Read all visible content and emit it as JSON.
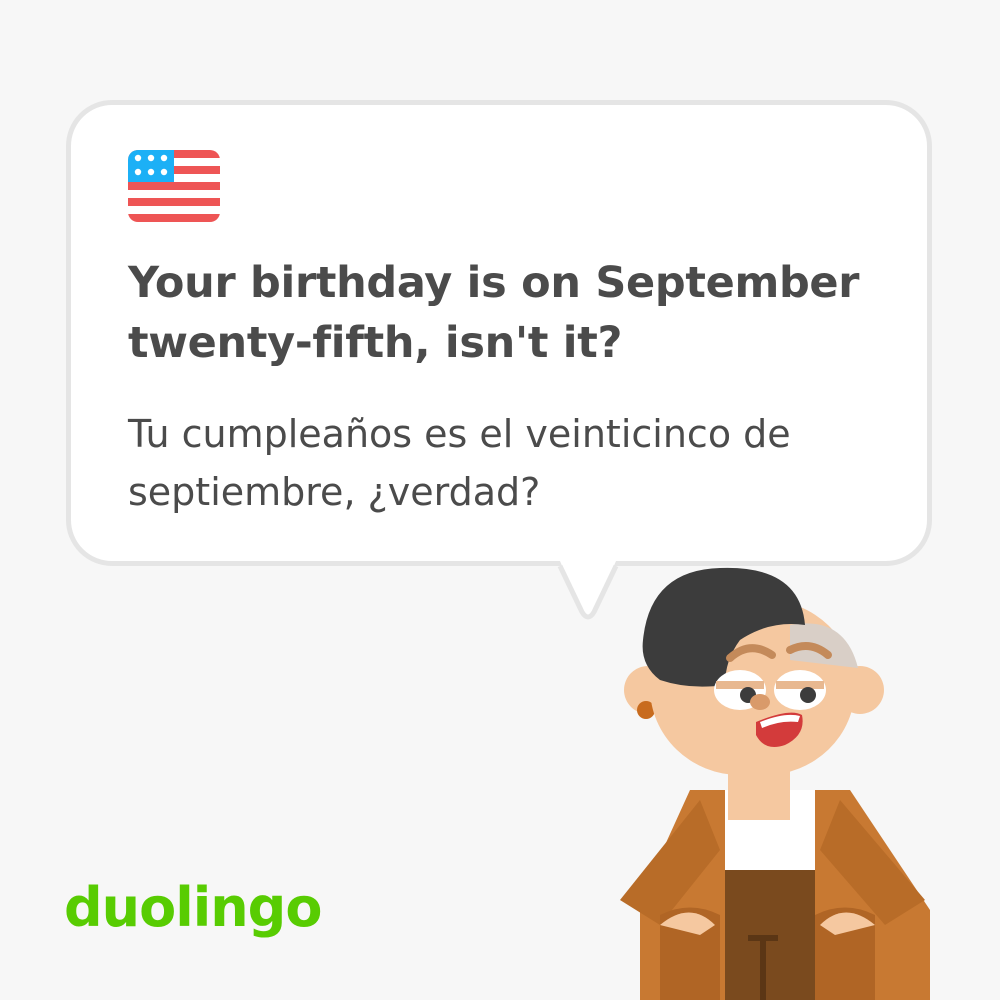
{
  "card": {
    "flag_icon": "us-flag-icon",
    "phrase": "Your birthday is on September twenty-fifth, isn't it?",
    "translation": "Tu cumpleaños es el veinticinco de septiembre, ¿verdad?"
  },
  "brand": {
    "logo_text": "duolingo",
    "color": "#58cc02"
  },
  "colors": {
    "background": "#f7f7f7",
    "bubble_border": "#e5e5e5",
    "text": "#4b4b4b"
  }
}
